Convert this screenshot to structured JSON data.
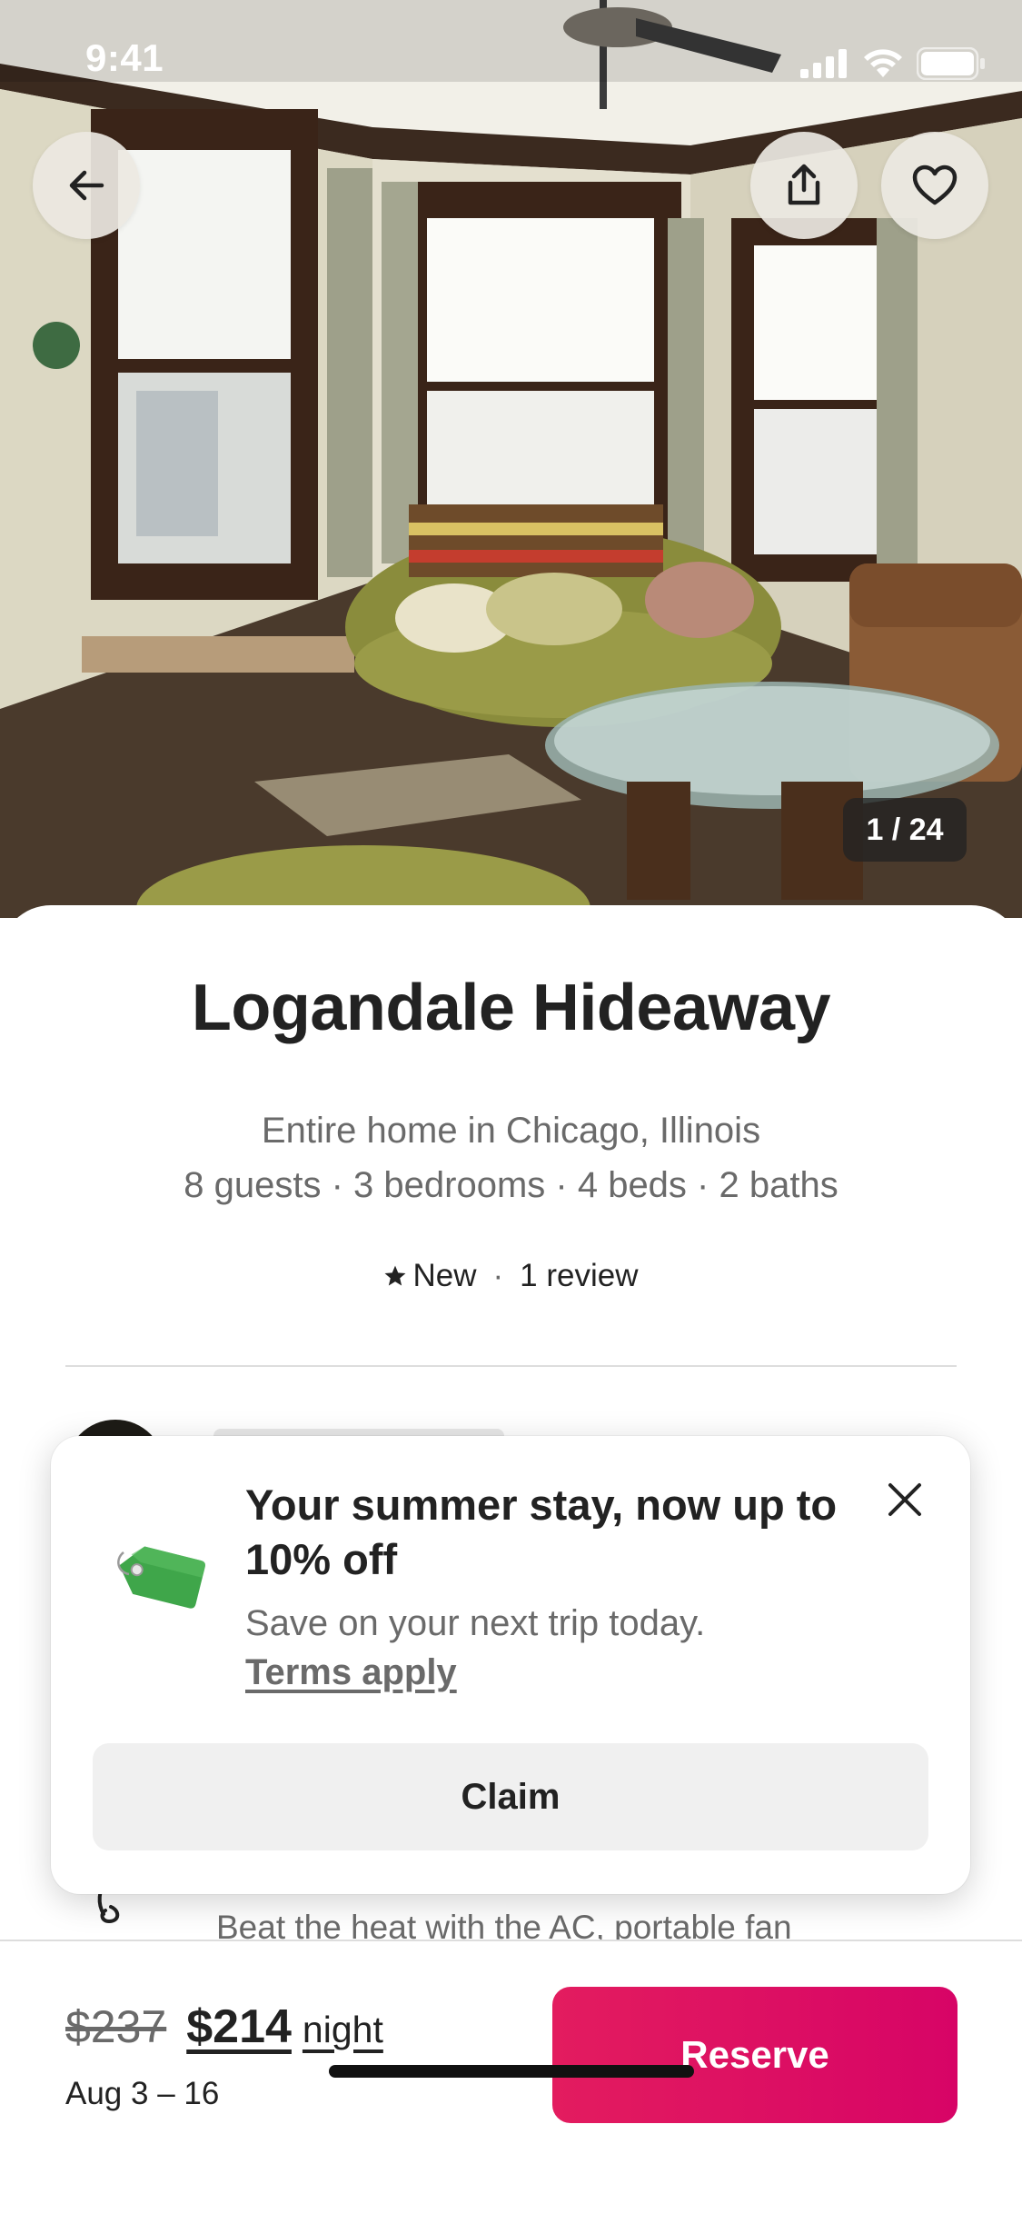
{
  "status_bar": {
    "time": "9:41"
  },
  "listing": {
    "title": "Logandale Hideaway",
    "location_line": "Entire home in Chicago, Illinois",
    "details_line": "8 guests · 3 bedrooms · 4 beds · 2 baths",
    "rating_label": "New",
    "rating_separator": "·",
    "reviews": "1 review"
  },
  "gallery": {
    "counter": "1 / 24"
  },
  "amenity": {
    "description": "Beat the heat with the AC, portable fan"
  },
  "promo": {
    "title": "Your summer stay, now up to 10% off",
    "body": "Save on your next trip today.",
    "terms": "Terms apply",
    "claim_label": "Claim"
  },
  "booking": {
    "original_price": "$237",
    "price": "$214",
    "unit": "night",
    "dates": "Aug 3 – 16",
    "reserve_label": "Reserve"
  },
  "icons": {
    "back": "arrow-left-icon",
    "share": "share-icon",
    "favorite": "heart-icon",
    "close": "close-icon",
    "star": "star-icon",
    "tag": "price-tag-icon"
  },
  "colors": {
    "brand": "#e31c5f",
    "text": "#222222",
    "secondary_text": "#6a6a6a",
    "tag_green": "#3fa64a"
  }
}
